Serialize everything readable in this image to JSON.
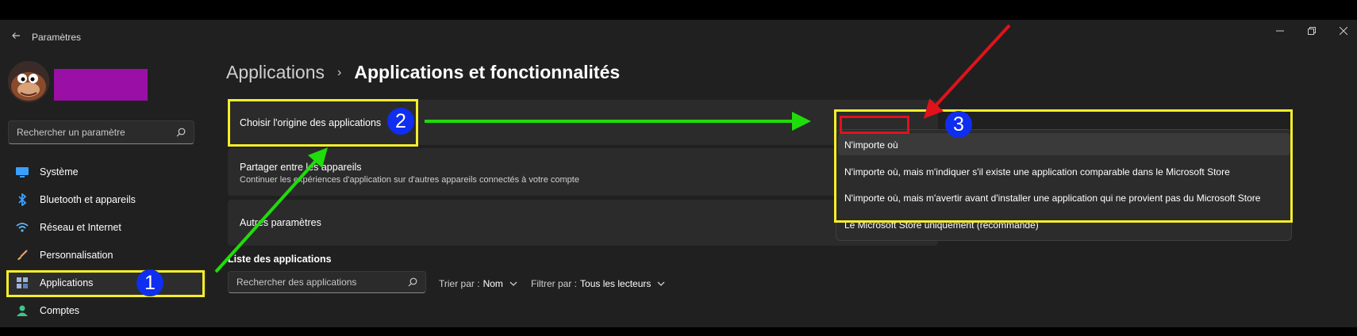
{
  "window": {
    "title": "Paramètres"
  },
  "search": {
    "placeholder": "Rechercher un paramètre"
  },
  "sidebar": {
    "items": [
      {
        "label": "Système",
        "icon": "display-icon"
      },
      {
        "label": "Bluetooth et appareils",
        "icon": "bluetooth-icon"
      },
      {
        "label": "Réseau et Internet",
        "icon": "wifi-icon"
      },
      {
        "label": "Personnalisation",
        "icon": "brush-icon"
      },
      {
        "label": "Applications",
        "icon": "apps-icon",
        "selected": true
      },
      {
        "label": "Comptes",
        "icon": "person-icon"
      }
    ]
  },
  "breadcrumb": {
    "parent": "Applications",
    "separator": "›",
    "current": "Applications et fonctionnalités"
  },
  "cards": {
    "origin": {
      "title": "Choisir l'origine des applications"
    },
    "share": {
      "title": "Partager entre les appareils",
      "subtitle": "Continuer les expériences d'application sur d'autres appareils connectés à votre compte"
    },
    "other": {
      "title": "Autres paramètres"
    }
  },
  "dropdown": {
    "options": [
      "N'importe où",
      "N'importe où, mais m'indiquer s'il existe une application comparable dans le Microsoft Store",
      "N'importe où, mais m'avertir avant d'installer une application qui ne provient pas du Microsoft Store",
      "Le Microsoft Store uniquement (recommandé)"
    ],
    "selected_index": 0
  },
  "apps_list": {
    "title": "Liste des applications",
    "search_placeholder": "Rechercher des applications",
    "sort_label": "Trier par :",
    "sort_value": "Nom",
    "filter_label": "Filtrer par :",
    "filter_value": "Tous les lecteurs"
  },
  "annotations": {
    "badge1": "1",
    "badge2": "2",
    "badge3": "3"
  },
  "colors": {
    "highlight": "#f5ee2a",
    "arrow_green": "#1fdd0a",
    "arrow_red": "#e0121b",
    "badge": "#0f2ef0",
    "profile": "#9a0fa6"
  }
}
